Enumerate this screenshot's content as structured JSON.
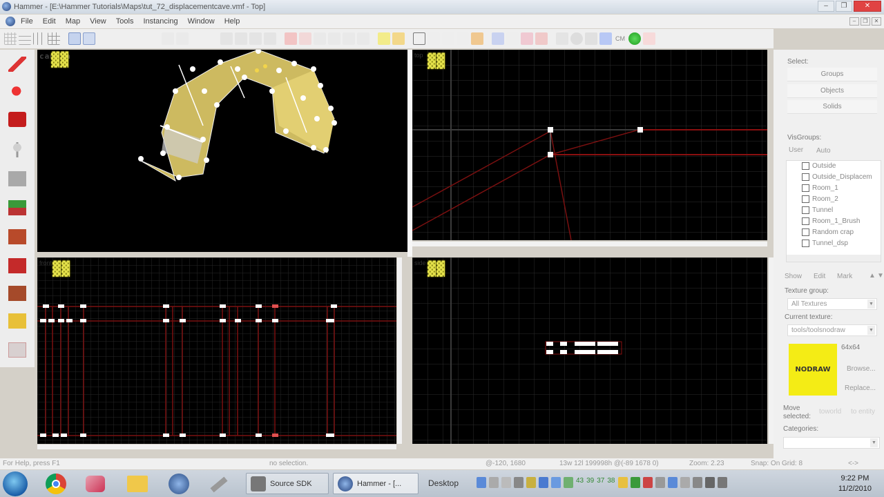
{
  "window": {
    "title": "Hammer - [E:\\Hammer Tutorials\\Maps\\tut_72_displacementcave.vmf - Top]"
  },
  "menu": [
    "File",
    "Edit",
    "Map",
    "View",
    "Tools",
    "Instancing",
    "Window",
    "Help"
  ],
  "toolbar": {
    "cm_label": "CM"
  },
  "viewports": {
    "camera": {
      "label": "camera"
    },
    "top": {
      "label": "top"
    },
    "front": {
      "label": "front"
    },
    "side": {
      "label": "side"
    }
  },
  "right_panel": {
    "select_label": "Select:",
    "select_buttons": [
      "Groups",
      "Objects",
      "Solids"
    ],
    "visgroups_label": "VisGroups:",
    "visgroup_tabs": [
      "User",
      "Auto"
    ],
    "visgroups": [
      "Outside",
      "Outside_Displacem",
      "Room_1",
      "Room_2",
      "Tunnel",
      "Room_1_Brush",
      "Random crap",
      "Tunnel_dsp"
    ],
    "visgroup_buttons": [
      "Show",
      "Edit",
      "Mark"
    ],
    "texture_group_label": "Texture group:",
    "texture_group_value": "All Textures",
    "current_texture_label": "Current texture:",
    "current_texture_value": "tools/toolsnodraw",
    "texture_preview_text": "NODRAW",
    "texture_size": "64x64",
    "browse_button": "Browse...",
    "replace_button": "Replace...",
    "move_selected_label": "Move selected:",
    "move_buttons": [
      "toworld",
      "to entity"
    ],
    "categories_label": "Categories:"
  },
  "status": {
    "help": "For Help, press F1",
    "selection": "no selection.",
    "coords": "@-120, 1680",
    "brush_dims": "13w 12l 199998h @(-89 1678 0)",
    "zoom": "Zoom: 2.23",
    "snap": "Snap: On Grid: 8",
    "extra": "<->"
  },
  "taskbar": {
    "tasks": [
      "Source SDK",
      "Hammer - [..."
    ],
    "desktop_label": "Desktop",
    "tray_numbers": [
      "43",
      "39",
      "37",
      "38"
    ],
    "time": "9:22 PM",
    "date": "11/2/2010"
  }
}
